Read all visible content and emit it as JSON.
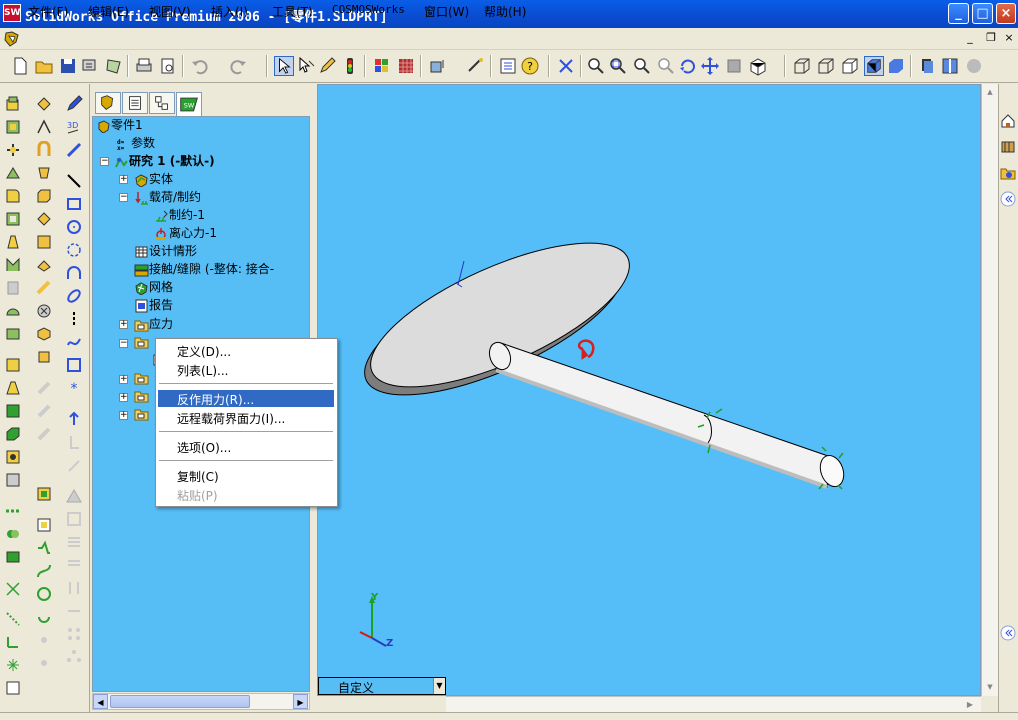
{
  "window": {
    "app_icon": "SW",
    "title": "SolidWorks Office Premium 2006 - [零件1.SLDPRT]",
    "minimize": "_",
    "maximize": "□",
    "close": "×"
  },
  "menubar": {
    "items": [
      {
        "label": "文件(F)"
      },
      {
        "label": "编辑(E)"
      },
      {
        "label": "视图(V)"
      },
      {
        "label": "插入(I)"
      },
      {
        "label": "工具(T)"
      },
      {
        "label": "COSMOSWorks"
      },
      {
        "label": "窗口(W)"
      },
      {
        "label": "帮助(H)"
      }
    ],
    "mdi_minimize": "_",
    "mdi_restore": "❐",
    "mdi_close": "×"
  },
  "tree": {
    "root": "零件1",
    "parameters": "参数",
    "study": "研究 1 (-默认-)",
    "solids": "实体",
    "loads": "载荷/制约",
    "fixture": "制约-1",
    "centrifugal": "离心力-1",
    "design_scenarios": "设计情形",
    "contact": "接触/缝隙 (-整体: 接合-",
    "mesh": "网格",
    "report": "报告",
    "stress": "应力",
    "folder_expand": "+",
    "folder_collapse": "−"
  },
  "context_menu": {
    "items": [
      {
        "label": "定义(D)...",
        "enabled": true
      },
      {
        "label": "列表(L)...",
        "enabled": true
      },
      {
        "label": "反作用力(R)...",
        "enabled": true,
        "highlighted": true
      },
      {
        "label": "远程载荷界面力(I)...",
        "enabled": true
      },
      {
        "label": "选项(O)...",
        "enabled": true
      },
      {
        "label": "复制(C)",
        "enabled": true
      },
      {
        "label": "粘贴(P)",
        "enabled": false
      }
    ]
  },
  "viewport": {
    "view_name": "自定义",
    "background_color": "#55bef8",
    "triad_y": "Y",
    "triad_z": "Z"
  },
  "colors": {
    "titlebar": "#0a4bd0",
    "highlight": "#316ac5",
    "tree_bg": "#56bdf5"
  }
}
